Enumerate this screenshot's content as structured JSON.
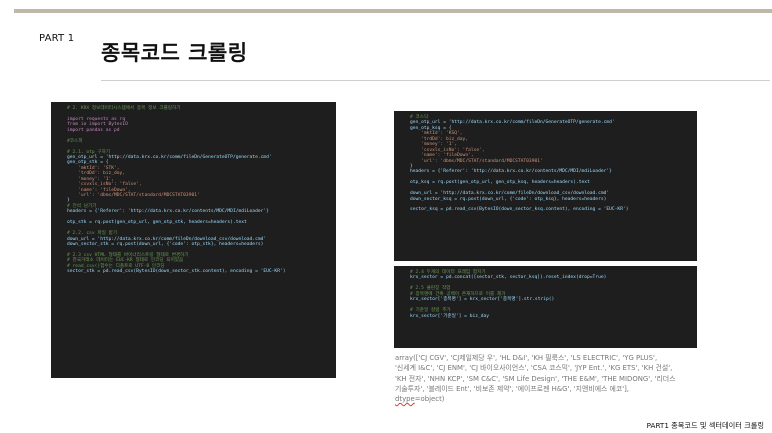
{
  "header": {
    "part_label": "PART 1",
    "title": "종목코드 크롤링"
  },
  "code_panels": [
    {
      "lines": [
        {
          "t": "# 2. KRX 정보데이터시스템에서 종목 정보 크롤링하기",
          "c": "com"
        },
        {
          "t": "",
          "c": "def"
        },
        {
          "t": "import requests as rq",
          "c": "kw"
        },
        {
          "t": "from io import BytesIO",
          "c": "kw"
        },
        {
          "t": "import pandas as pd",
          "c": "kw"
        },
        {
          "t": "",
          "c": "def"
        },
        {
          "t": "#코스피",
          "c": "com"
        },
        {
          "t": "",
          "c": "def"
        },
        {
          "t": "# 2.1. otp 구하기",
          "c": "com"
        },
        {
          "t": "gen_otp_url = 'http://data.krx.co.kr/comm/fileDn/GenerateOTP/generate.cmd'",
          "c": "var"
        },
        {
          "t": "gen_otp_stk = {",
          "c": "var"
        },
        {
          "t": "    'mktId': 'STK',",
          "c": "str"
        },
        {
          "t": "    'trdDd': biz_day,",
          "c": "str"
        },
        {
          "t": "    'money': '1',",
          "c": "str"
        },
        {
          "t": "    'csvxls_isNo': 'false',",
          "c": "str"
        },
        {
          "t": "    'name': 'fileDown',",
          "c": "str"
        },
        {
          "t": "    'url': 'dbms/MDC/STAT/standard/MDCSTAT03901'",
          "c": "str"
        },
        {
          "t": "}",
          "c": "def"
        },
        {
          "t": "# 전석 남기기",
          "c": "com"
        },
        {
          "t": "headers = {'Referer': 'http://data.krx.co.kr/contents/MDC/MDI/mdiLoader'}",
          "c": "var"
        },
        {
          "t": "",
          "c": "def"
        },
        {
          "t": "otp_stk = rq.post(gen_otp_url, gen_otp_stk, headers=headers).text",
          "c": "var"
        },
        {
          "t": "",
          "c": "def"
        },
        {
          "t": "# 2.2. csv 파일 받기",
          "c": "com"
        },
        {
          "t": "down_url = 'http://data.krx.co.kr/comm/fileDn/download_csv/download.cmd'",
          "c": "var"
        },
        {
          "t": "down_sector_stk = rq.post(down_url, {'code': otp_stk}, headers=headers)",
          "c": "var"
        },
        {
          "t": "",
          "c": "def"
        },
        {
          "t": "# 2.3 csv HTML 형태를 바이너리스트링 형태로 변경하기",
          "c": "com"
        },
        {
          "t": "# 한국거래소 데이터는 EUC-KR 형태로 인코딩 되어있음",
          "c": "com"
        },
        {
          "t": "# read_csv()함수는 디폴트로 UTF-8 인코딩",
          "c": "com"
        },
        {
          "t": "sector_stk = pd.read_csv(BytesIO(down_sector_stk.content), encoding = 'EUC-KR')",
          "c": "var"
        }
      ]
    },
    {
      "lines": [
        {
          "t": "# 코스닥",
          "c": "com"
        },
        {
          "t": "gen_otp_url = 'http://data.krx.co.kr/comm/fileDn/GenerateOTP/generate.cmd'",
          "c": "var"
        },
        {
          "t": "gen_otp_ksq = {",
          "c": "var"
        },
        {
          "t": "    'mktId': 'KSQ',",
          "c": "str"
        },
        {
          "t": "    'trdDd': biz_day,",
          "c": "str"
        },
        {
          "t": "    'money': '1',",
          "c": "str"
        },
        {
          "t": "    'csvxls_isNo': 'false',",
          "c": "str"
        },
        {
          "t": "    'name': 'fileDown',",
          "c": "str"
        },
        {
          "t": "    'url': 'dbms/MDC/STAT/standard/MDCSTAT03901'",
          "c": "str"
        },
        {
          "t": "}",
          "c": "def"
        },
        {
          "t": "headers = {'Referer': 'http://data.krx.co.kr/contents/MDC/MDI/mdiLoader'}",
          "c": "var"
        },
        {
          "t": "",
          "c": "def"
        },
        {
          "t": "otp_ksq = rq.post(gen_otp_url, gen_otp_ksq, headers=headers).text",
          "c": "var"
        },
        {
          "t": "",
          "c": "def"
        },
        {
          "t": "down_url = 'http://data.krx.co.kr/comm/fileDn/download_csv/download.cmd'",
          "c": "var"
        },
        {
          "t": "down_sector_ksq = rq.post(down_url, {'code': otp_ksq}, headers=headers)",
          "c": "var"
        },
        {
          "t": "",
          "c": "def"
        },
        {
          "t": "sector_ksq = pd.read_csv(BytesIO(down_sector_ksq.content), encoding = 'EUC-KR')",
          "c": "var"
        }
      ]
    },
    {
      "lines": [
        {
          "t": "# 2.4 두개의 데이터 프레임 합치기",
          "c": "com"
        },
        {
          "t": "krx_sector = pd.concat([sector_stk, sector_ksq]).reset_index(drop=True)",
          "c": "var"
        },
        {
          "t": "",
          "c": "def"
        },
        {
          "t": "# 2.5 클린징 작업",
          "c": "com"
        },
        {
          "t": "# 종목명에 간혹 공백이 존재하므로 이를 제거",
          "c": "com"
        },
        {
          "t": "krx_sector['종목명'] = krx_sector['종목명'].str.strip()",
          "c": "var"
        },
        {
          "t": "",
          "c": "def"
        },
        {
          "t": "# 기준일 칼럼 추가",
          "c": "com"
        },
        {
          "t": "krx_sector['기준일'] = biz_day",
          "c": "var"
        }
      ]
    }
  ],
  "output_text": {
    "line1": "array(['CJ CGV', 'CJ제일제당 우', 'HL D&I', 'KH 필룩스', 'LS ELECTRIC', 'YG PLUS',",
    "line2": "'신세계 I&C', 'CJ ENM', 'CJ 바이오사이언스', 'CSA 코스믹', 'JYP Ent.', 'KG ETS', 'KH 건설',",
    "line3": "'KH 전자', 'NHN KCP', 'SM C&C', 'SM Life Design', 'THE E&M', 'THE MIDONG', '리더스",
    "line4": "기술투자', '블레이드 Ent', '비보존 제약', '에이프로젠 H&G', '지앤비에스 에코'],",
    "dtype_word": "dtype",
    "dtype_rest": "=object)"
  },
  "footer": {
    "text": "PART1 종목코드 및 섹터데이터 크롤링"
  },
  "colors": {
    "top_bar": "#bfb7a7",
    "code_background": "#1e1e1e",
    "comment": "#6a9955",
    "keyword": "#c586c0",
    "variable": "#9cdcfe",
    "string": "#ce9178"
  }
}
